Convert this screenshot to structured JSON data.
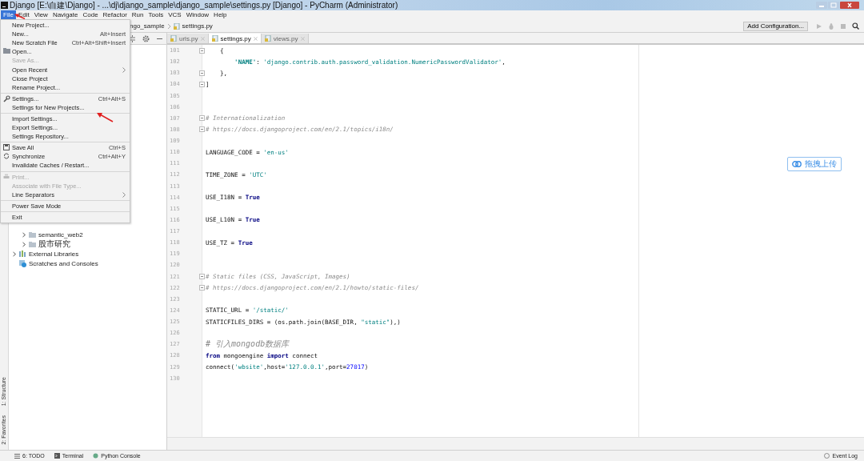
{
  "window": {
    "title": "Django [E:\\自建\\Django] - ...\\dj\\django_sample\\django_sample\\settings.py [Django] - PyCharm (Administrator)"
  },
  "menubar": [
    {
      "label": "File",
      "selected": true
    },
    {
      "label": "Edit",
      "selected": false
    },
    {
      "label": "View",
      "selected": false
    },
    {
      "label": "Navigate",
      "selected": false
    },
    {
      "label": "Code",
      "selected": false
    },
    {
      "label": "Refactor",
      "selected": false
    },
    {
      "label": "Run",
      "selected": false
    },
    {
      "label": "Tools",
      "selected": false
    },
    {
      "label": "VCS",
      "selected": false
    },
    {
      "label": "Window",
      "selected": false
    },
    {
      "label": "Help",
      "selected": false
    }
  ],
  "file_menu": [
    {
      "kind": "item",
      "label": "New Project...",
      "disabled": false,
      "submenu": false
    },
    {
      "kind": "item",
      "label": "New...",
      "shortcut": "Alt+Insert",
      "disabled": false,
      "submenu": false
    },
    {
      "kind": "item",
      "label": "New Scratch File",
      "shortcut": "Ctrl+Alt+Shift+Insert",
      "disabled": false,
      "submenu": false
    },
    {
      "kind": "item",
      "label": "Open...",
      "disabled": false,
      "submenu": false
    },
    {
      "kind": "item",
      "label": "Save As...",
      "disabled": true,
      "submenu": false
    },
    {
      "kind": "item",
      "label": "Open Recent",
      "disabled": false,
      "submenu": true
    },
    {
      "kind": "item",
      "label": "Close Project",
      "disabled": false,
      "submenu": false
    },
    {
      "kind": "item",
      "label": "Rename Project...",
      "disabled": false,
      "submenu": false
    },
    {
      "kind": "separator"
    },
    {
      "kind": "item",
      "label": "Settings...",
      "shortcut": "Ctrl+Alt+S",
      "disabled": false,
      "submenu": false
    },
    {
      "kind": "item",
      "label": "Settings for New Projects...",
      "disabled": false,
      "submenu": false
    },
    {
      "kind": "separator"
    },
    {
      "kind": "item",
      "label": "Import Settings...",
      "disabled": false,
      "submenu": false
    },
    {
      "kind": "item",
      "label": "Export Settings...",
      "disabled": false,
      "submenu": false
    },
    {
      "kind": "item",
      "label": "Settings Repository...",
      "disabled": false,
      "submenu": false
    },
    {
      "kind": "separator"
    },
    {
      "kind": "item",
      "label": "Save All",
      "shortcut": "Ctrl+S",
      "disabled": false,
      "submenu": false
    },
    {
      "kind": "item",
      "label": "Synchronize",
      "shortcut": "Ctrl+Alt+Y",
      "disabled": false,
      "submenu": false
    },
    {
      "kind": "item",
      "label": "Invalidate Caches / Restart...",
      "disabled": false,
      "submenu": false
    },
    {
      "kind": "separator"
    },
    {
      "kind": "item",
      "label": "Print...",
      "disabled": true,
      "submenu": false
    },
    {
      "kind": "item",
      "label": "Associate with File Type...",
      "disabled": true,
      "submenu": false
    },
    {
      "kind": "item",
      "label": "Line Separators",
      "disabled": false,
      "submenu": true
    },
    {
      "kind": "separator"
    },
    {
      "kind": "item",
      "label": "Power Save Mode",
      "disabled": false,
      "submenu": false
    },
    {
      "kind": "separator"
    },
    {
      "kind": "item",
      "label": "Exit",
      "disabled": false,
      "submenu": false
    }
  ],
  "navbar": {
    "breadcrumbs": [
      "ngo_sample",
      "settings.py"
    ],
    "add_configuration": "Add Configuration..."
  },
  "left_stripe": [
    "1: Structure",
    "2: Favorites"
  ],
  "project_tree": [
    {
      "children": [
        {
          "label": "semantic_web2",
          "expanded": false
        },
        {
          "label": "股市研究",
          "expanded": false
        }
      ]
    },
    {
      "label": "External Libraries",
      "expanded": false
    },
    {
      "label": "Scratches and Consoles"
    }
  ],
  "editor_tabs": [
    {
      "label": "urls.py",
      "selected": false
    },
    {
      "label": "settings.py",
      "selected": true
    },
    {
      "label": "views.py",
      "selected": false
    }
  ],
  "code_lines": [
    {
      "number": "101",
      "fold": true,
      "tokens": [
        {
          "kind": "plain",
          "text": "    {"
        }
      ]
    },
    {
      "number": "102",
      "fold": false,
      "tokens": [
        {
          "kind": "key",
          "text": "        'NAME'"
        },
        {
          "kind": "plain",
          "text": ": "
        },
        {
          "kind": "string",
          "text": "'django.contrib.auth.password_validation.NumericPasswordValidator'"
        },
        {
          "kind": "plain",
          "text": ","
        }
      ]
    },
    {
      "number": "103",
      "fold": true,
      "tokens": [
        {
          "kind": "plain",
          "text": "    },"
        }
      ]
    },
    {
      "number": "104",
      "fold": true,
      "tokens": [
        {
          "kind": "plain",
          "text": "]"
        }
      ]
    },
    {
      "number": "105",
      "fold": false
    },
    {
      "number": "106",
      "fold": false
    },
    {
      "number": "107",
      "fold": true,
      "tokens": [
        {
          "kind": "comment",
          "text": "# Internationalization"
        }
      ]
    },
    {
      "number": "108",
      "fold": true,
      "tokens": [
        {
          "kind": "comment",
          "text": "# https://docs.djangoproject.com/en/2.1/topics/i18n/"
        }
      ]
    },
    {
      "number": "109",
      "fold": false
    },
    {
      "number": "110",
      "fold": false,
      "tokens": [
        {
          "kind": "plain",
          "text": "LANGUAGE_CODE = "
        },
        {
          "kind": "string",
          "text": "'en-us'"
        }
      ]
    },
    {
      "number": "111",
      "fold": false
    },
    {
      "number": "112",
      "fold": false,
      "tokens": [
        {
          "kind": "plain",
          "text": "TIME_ZONE = "
        },
        {
          "kind": "string",
          "text": "'UTC'"
        }
      ]
    },
    {
      "number": "113",
      "fold": false
    },
    {
      "number": "114",
      "fold": false,
      "tokens": [
        {
          "kind": "plain",
          "text": "USE_I18N = "
        },
        {
          "kind": "keyword",
          "text": "True"
        }
      ]
    },
    {
      "number": "115",
      "fold": false
    },
    {
      "number": "116",
      "fold": false,
      "tokens": [
        {
          "kind": "plain",
          "text": "USE_L10N = "
        },
        {
          "kind": "keyword",
          "text": "True"
        }
      ]
    },
    {
      "number": "117",
      "fold": false
    },
    {
      "number": "118",
      "fold": false,
      "tokens": [
        {
          "kind": "plain",
          "text": "USE_TZ = "
        },
        {
          "kind": "keyword",
          "text": "True"
        }
      ]
    },
    {
      "number": "119",
      "fold": false
    },
    {
      "number": "120",
      "fold": false
    },
    {
      "number": "121",
      "fold": true,
      "tokens": [
        {
          "kind": "comment",
          "text": "# Static files (CSS, JavaScript, Images)"
        }
      ]
    },
    {
      "number": "122",
      "fold": true,
      "tokens": [
        {
          "kind": "comment",
          "text": "# https://docs.djangoproject.com/en/2.1/howto/static-files/"
        }
      ]
    },
    {
      "number": "123",
      "fold": false
    },
    {
      "number": "124",
      "fold": false,
      "tokens": [
        {
          "kind": "plain",
          "text": "STATIC_URL = "
        },
        {
          "kind": "string",
          "text": "'/static/'"
        }
      ]
    },
    {
      "number": "125",
      "fold": false,
      "tokens": [
        {
          "kind": "plain",
          "text": "STATICFILES_DIRS = (os.path.join(BASE_DIR, "
        },
        {
          "kind": "string",
          "text": "\"static\""
        },
        {
          "kind": "plain",
          "text": "),)"
        }
      ]
    },
    {
      "number": "126",
      "fold": false
    },
    {
      "number": "127",
      "fold": false,
      "tokens": [
        {
          "kind": "comment",
          "text": "# 引入mongodb数据库"
        }
      ]
    },
    {
      "number": "128",
      "fold": false,
      "tokens": [
        {
          "kind": "keyword",
          "text": "from"
        },
        {
          "kind": "plain",
          "text": " mongoengine "
        },
        {
          "kind": "keyword",
          "text": "import"
        },
        {
          "kind": "plain",
          "text": " connect"
        }
      ]
    },
    {
      "number": "129",
      "fold": false,
      "tokens": [
        {
          "kind": "plain",
          "text": "connect("
        },
        {
          "kind": "string",
          "text": "'wbsite'"
        },
        {
          "kind": "plain",
          "text": ",host="
        },
        {
          "kind": "string",
          "text": "'127.0.0.1'"
        },
        {
          "kind": "plain",
          "text": ",port="
        },
        {
          "kind": "number",
          "text": "27017"
        },
        {
          "kind": "plain",
          "text": ")"
        }
      ]
    },
    {
      "number": "130",
      "fold": false
    }
  ],
  "upload_widget": {
    "label": "拖拽上传"
  },
  "bottom_tools": {
    "left": [
      "6: TODO",
      "Terminal",
      "Python Console"
    ],
    "right": [
      "Event Log"
    ]
  }
}
